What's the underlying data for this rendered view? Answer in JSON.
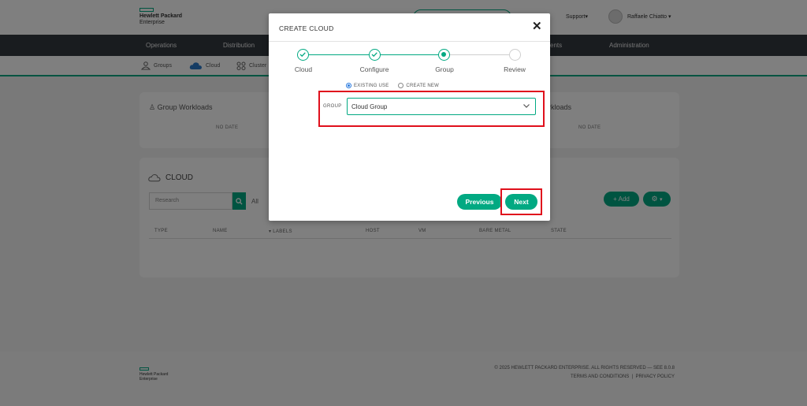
{
  "brand": {
    "line1": "Hewlett Packard",
    "line2": "Enterprise"
  },
  "header": {
    "support_label": "Support",
    "user_name": "Raffaele Chiatto"
  },
  "nav": {
    "items": [
      "Operations",
      "Distribution",
      "ents",
      "Administration"
    ]
  },
  "subnav": {
    "items": [
      {
        "label": "Groups",
        "icon": "groups-icon"
      },
      {
        "label": "Cloud",
        "icon": "cloud-icon"
      },
      {
        "label": "Cluster",
        "icon": "cluster-icon"
      }
    ]
  },
  "cards": {
    "left_title": "Group Workloads",
    "left_empty": "NO DATE",
    "right_title": "rkloads",
    "right_empty": "NO DATE"
  },
  "cloud_section": {
    "title": "CLOUD",
    "search_placeholder": "Research",
    "filter_label": "All",
    "add_label": "+ Add",
    "columns": [
      "TYPE",
      "NAME",
      "LABELS",
      "HOST",
      "VM",
      "BARE METAL",
      "STATE"
    ]
  },
  "footer": {
    "copyright": "© 2025 HEWLETT PACKARD ENTERPRISE. ALL RIGHTS RESERVED — SEE 8.0.8",
    "terms": "TERMS AND CONDITIONS",
    "separator": "|",
    "privacy": "PRIVACY POLICY",
    "logo_line1": "Hewlett Packard",
    "logo_line2": "Enterprise"
  },
  "modal": {
    "title": "CREATE CLOUD",
    "close_glyph": "✕",
    "steps": [
      {
        "label": "Cloud",
        "state": "done"
      },
      {
        "label": "Configure",
        "state": "done"
      },
      {
        "label": "Group",
        "state": "active"
      },
      {
        "label": "Review",
        "state": "pending"
      }
    ],
    "radio_existing": "EXISTING USE",
    "radio_new": "CREATE NEW",
    "group_label": "GROUP",
    "group_value": "Cloud Group",
    "previous_label": "Previous",
    "next_label": "Next"
  },
  "colors": {
    "accent": "#01a982",
    "nav_bg": "#32383f",
    "highlight": "#e0101c",
    "radio_selected": "#2a7ade"
  }
}
